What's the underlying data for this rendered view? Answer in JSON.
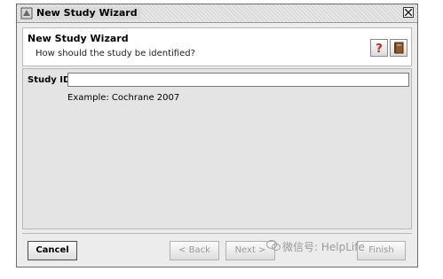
{
  "window": {
    "title": "New Study Wizard"
  },
  "header": {
    "title": "New Study Wizard",
    "subtitle": "How should the study be identified?"
  },
  "form": {
    "study_id_label": "Study ID:",
    "study_id_value": "",
    "example_text": "Example: Cochrane 2007"
  },
  "buttons": {
    "cancel": "Cancel",
    "back": "< Back",
    "next": "Next >",
    "finish": "Finish"
  },
  "watermark": {
    "text": "微信号: HelpLife"
  },
  "icons": {
    "app": "wizard-app-icon",
    "close": "close-icon",
    "help": "help-icon",
    "book": "book-icon"
  },
  "colors": {
    "help_red": "#cc2222",
    "book_brown": "#8b5a2b"
  }
}
